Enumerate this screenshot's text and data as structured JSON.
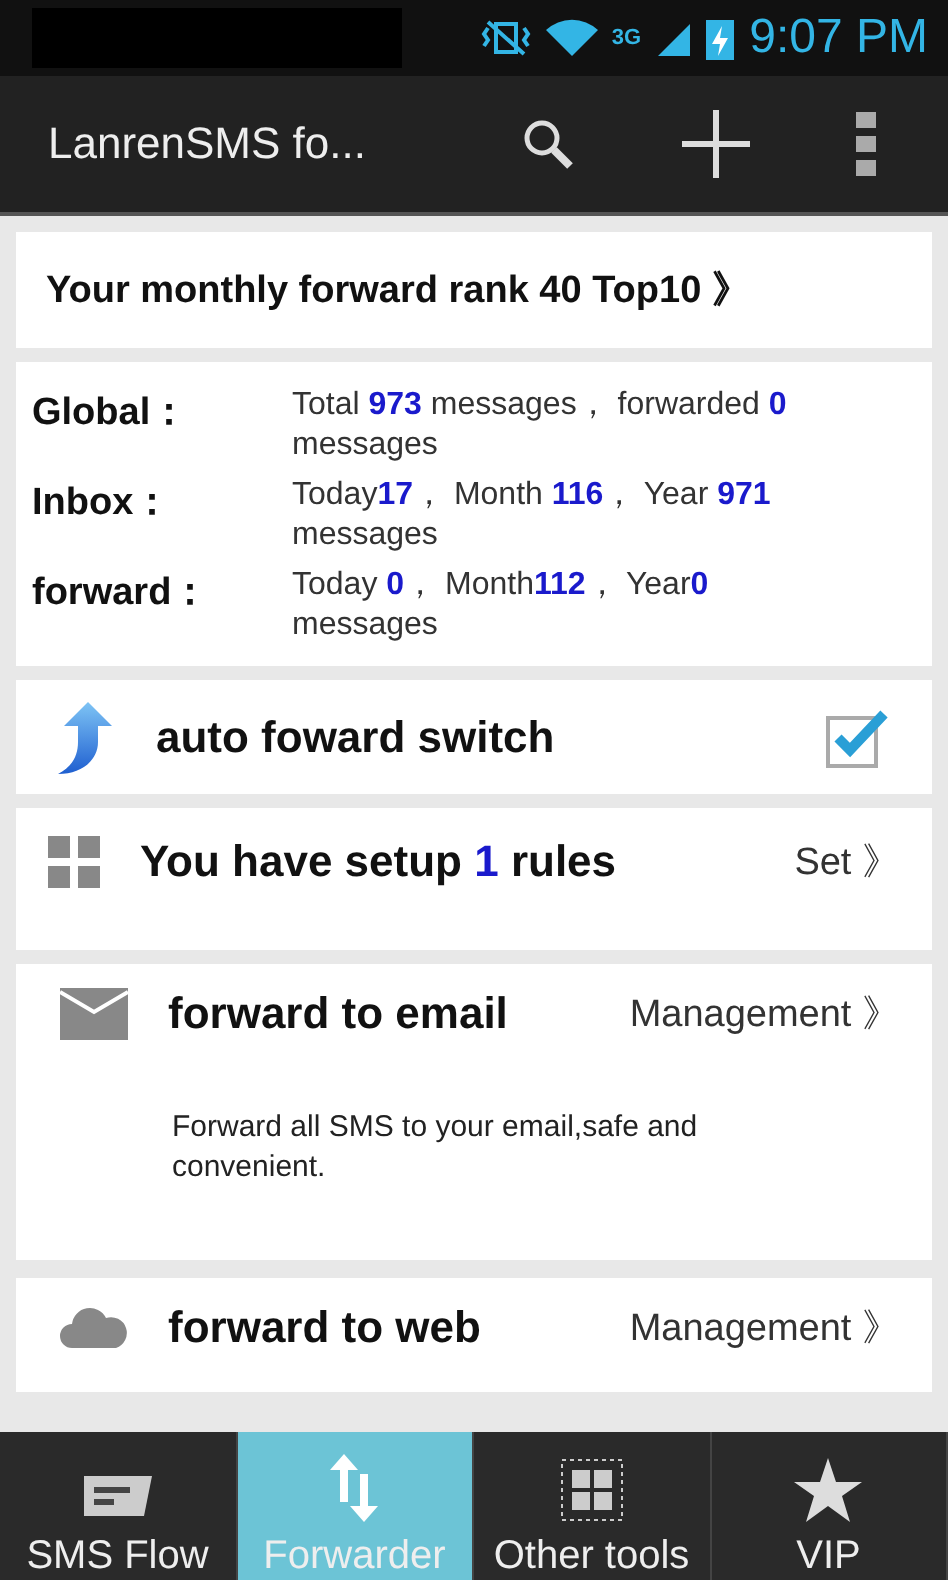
{
  "status_bar": {
    "network": "3G",
    "time": "9:07 PM"
  },
  "action_bar": {
    "title": "LanrenSMS fo..."
  },
  "rank": {
    "text": "Your monthly forward rank 40 Top10 》"
  },
  "stats": [
    {
      "label": "Global：",
      "text": "Total **973** messages， forwarded **0** messages"
    },
    {
      "label": "Inbox：",
      "text": "Today**17**， Month **116**， Year **971** messages"
    },
    {
      "label": "forward：",
      "text": "Today **0**， Month**112**， Year**0** messages"
    }
  ],
  "auto_switch": {
    "label": "auto foward switch",
    "checked": true
  },
  "rules": {
    "text": "You have setup **1** rules",
    "action": "Set 》"
  },
  "targets": [
    {
      "kind": "email",
      "title": "forward to email",
      "action": "Management 》",
      "description": "Forward all SMS to your email,safe and convenient."
    },
    {
      "kind": "web",
      "title": "forward to web",
      "action": "Management 》"
    }
  ],
  "tabs": [
    {
      "kind": "flow",
      "label": "SMS Flow",
      "selected": false
    },
    {
      "kind": "forwarder",
      "label": "Forwarder",
      "selected": true
    },
    {
      "kind": "tools",
      "label": "Other tools",
      "selected": false
    },
    {
      "kind": "vip",
      "label": "VIP",
      "selected": false
    }
  ]
}
